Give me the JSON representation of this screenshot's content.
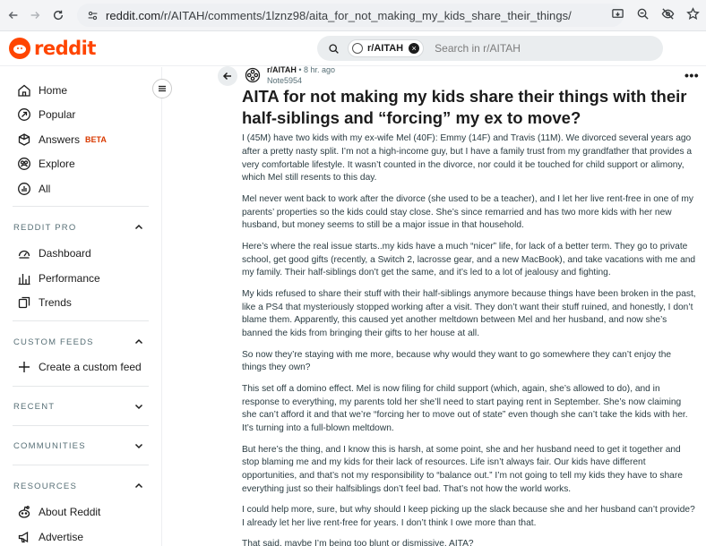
{
  "browser": {
    "url_domain": "reddit.com",
    "url_path": "/r/AITAH/comments/1lznz98/aita_for_not_making_my_kids_share_their_things/"
  },
  "header": {
    "logo_text": "reddit",
    "search_chip": "r/AITAH",
    "search_placeholder": "Search in r/AITAH"
  },
  "sidebar": {
    "main": [
      {
        "label": "Home",
        "icon": "home-icon"
      },
      {
        "label": "Popular",
        "icon": "popular-icon"
      },
      {
        "label": "Answers",
        "icon": "answers-icon",
        "badge": "BETA"
      },
      {
        "label": "Explore",
        "icon": "explore-icon"
      },
      {
        "label": "All",
        "icon": "all-icon"
      }
    ],
    "reddit_pro": {
      "title": "REDDIT PRO",
      "items": [
        "Dashboard",
        "Performance",
        "Trends"
      ]
    },
    "custom_feeds": {
      "title": "CUSTOM FEEDS",
      "items": [
        "Create a custom feed"
      ]
    },
    "recent": {
      "title": "RECENT"
    },
    "communities": {
      "title": "COMMUNITIES"
    },
    "resources": {
      "title": "RESOURCES",
      "items": [
        "About Reddit",
        "Advertise"
      ]
    }
  },
  "post": {
    "subreddit": "r/AITAH",
    "age": "• 8 hr. ago",
    "author": "Note5954",
    "title": "AITA for not making my kids share their things with their half-siblings and “forcing” my ex to move?",
    "paragraphs": [
      "I (45M) have two kids with my ex-wife Mel (40F): Emmy (14F) and Travis (11M). We divorced several years ago after a pretty nasty split. I’m not a high-income guy, but I have a family trust from my grandfather that provides a very comfortable lifestyle. It wasn’t counted in the divorce, nor could it be touched for child support or alimony, which Mel still resents to this day.",
      "Mel never went back to work after the divorce (she used to be a teacher), and I let her live rent-free in one of my parents’ properties so the kids could stay close. She’s since remarried and has two more kids with her new husband, but money seems to still be a major issue in that household.",
      "Here’s where the real issue starts..my kids have a much “nicer” life, for lack of a better term. They go to private school, get good gifts (recently, a Switch 2, lacrosse gear, and a new MacBook), and take vacations with me and my family. Their half-siblings don’t get the same, and it’s led to a lot of jealousy and fighting.",
      "My kids refused to share their stuff with their half-siblings anymore because things have been broken in the past, like a PS4 that mysteriously stopped working after a visit. They don’t want their stuff ruined, and honestly, I don’t blame them. Apparently, this caused yet another meltdown between Mel and her husband, and now she’s banned the kids from bringing their gifts to her house at all.",
      "So now they’re staying with me more, because why would they want to go somewhere they can’t enjoy the things they own?",
      "This set off a domino effect. Mel is now filing for child support (which, again, she’s allowed to do), and in response to everything, my parents told her she’ll need to start paying rent in September. She’s now claiming she can’t afford it and that we’re “forcing her to move out of state” even though she can’t take the kids with her. It’s turning into a full-blown meltdown.",
      "But here’s the thing, and I know this is harsh, at some point, she and her husband need to get it together and stop blaming me and my kids for their lack of resources. Life isn’t always fair. Our kids have different opportunities, and that’s not my responsibility to “balance out.” I’m not going to tell my kids they have to share everything just so their halfsiblings don’t feel bad. That’s not how the world works.",
      "I could help more, sure, but why should I keep picking up the slack because she and her husband can’t provide? I already let her live rent-free for years. I don’t think I owe more than that.",
      "That said, maybe I’m being too blunt or dismissive. AITA?"
    ]
  }
}
